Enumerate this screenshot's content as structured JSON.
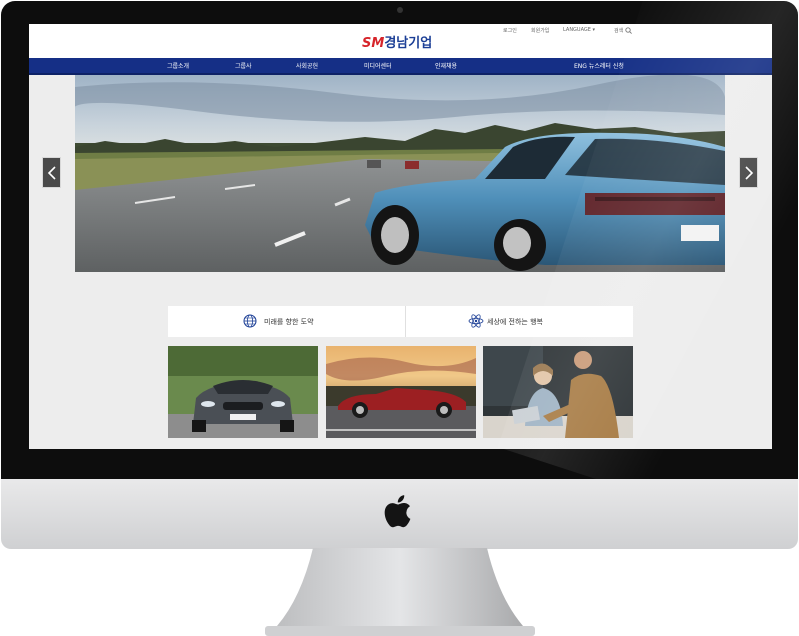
{
  "site": {
    "logo_sm": "SM",
    "logo_name": "경남기업",
    "util_links": [
      "로그인",
      "회원가입",
      "LANGUAGE ▾",
      "검색"
    ],
    "nav_items": [
      "그룹소개",
      "그룹사",
      "사회공헌",
      "미디어센터",
      "인재채용"
    ],
    "nav_right": "ENG  뉴스레터 신청",
    "tabs": [
      {
        "label": "미래를 향한 도약",
        "icon": "globe-icon"
      },
      {
        "label": "세상에 전하는 행복",
        "icon": "atom-icon"
      }
    ],
    "slider": {
      "prev_icon": "chevron-left-icon",
      "next_icon": "chevron-right-icon"
    },
    "cards": [
      "sports-car-photo",
      "red-convertible-photo",
      "meeting-photo"
    ]
  },
  "colors": {
    "nav": "#152f86",
    "brand_red": "#d6242a",
    "brand_blue": "#1c3f96",
    "page_bg": "#ededed"
  }
}
